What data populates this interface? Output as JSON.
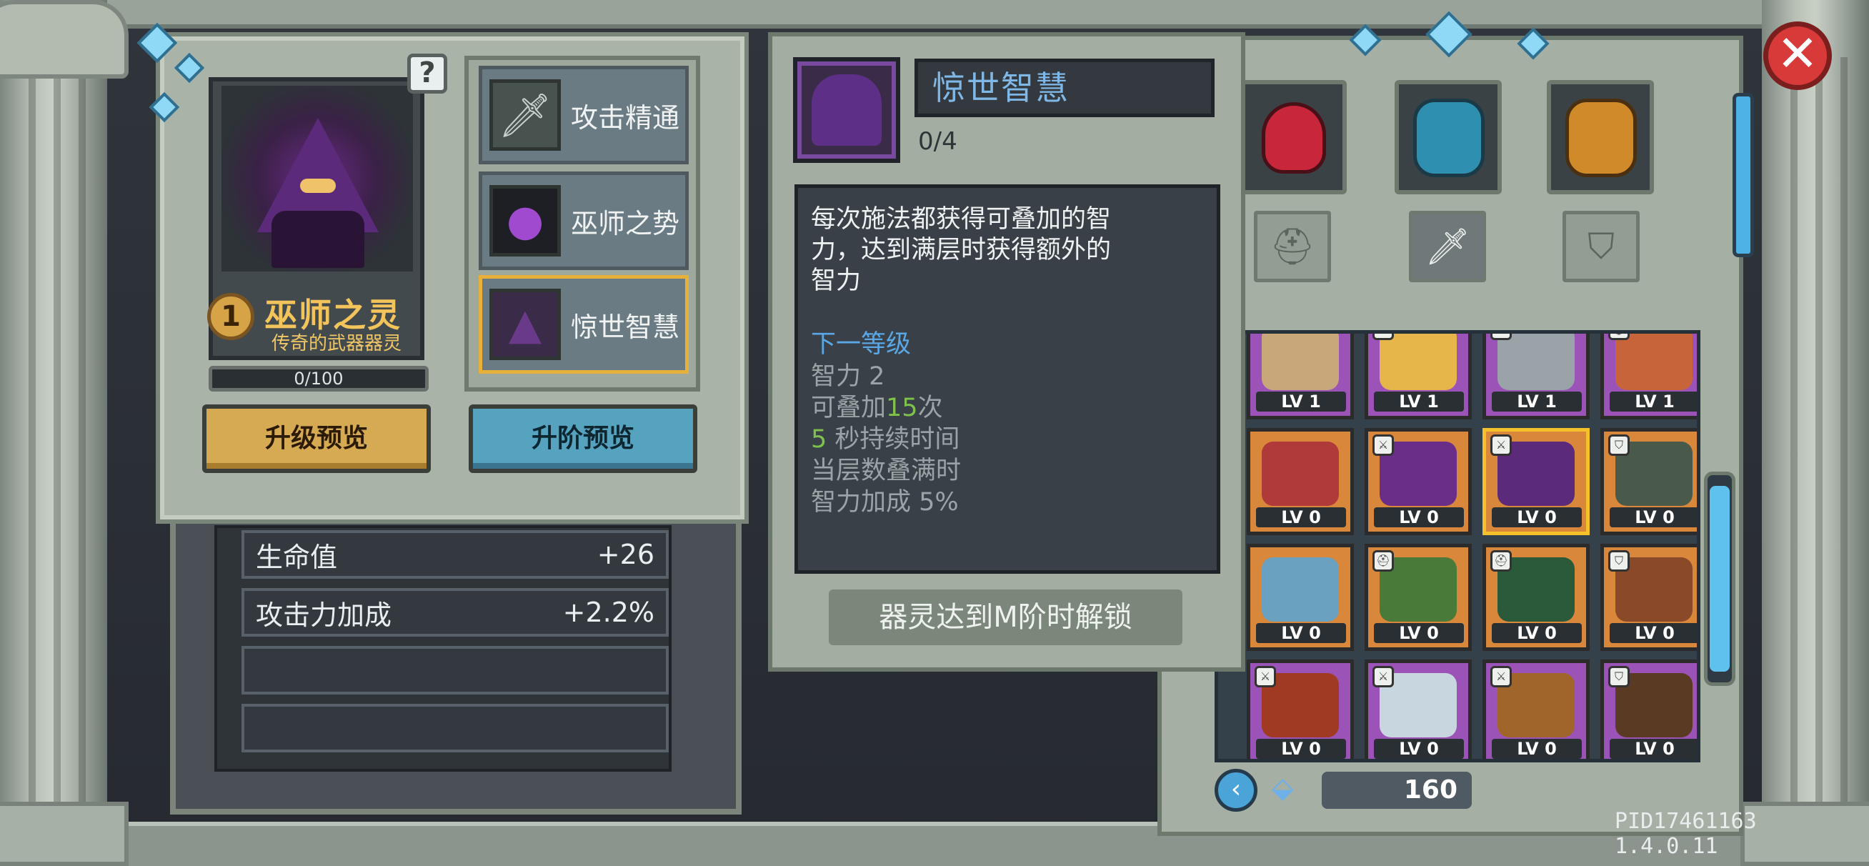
{
  "hero": {
    "rank": "1",
    "name": "巫师之灵",
    "subtitle": "传奇的武器器灵",
    "xp": "0/100",
    "help": "?"
  },
  "skills": [
    {
      "label": "攻击精通",
      "icon": "sword-icon"
    },
    {
      "label": "巫师之势",
      "icon": "purple-flame-icon"
    },
    {
      "label": "惊世智慧",
      "icon": "hood-icon"
    }
  ],
  "buttons": {
    "upgrade_preview": "升级预览",
    "ascend_preview": "升阶预览"
  },
  "stats": [
    {
      "label": "生命值",
      "value": "+26"
    },
    {
      "label": "攻击力加成",
      "value": "+2.2%"
    },
    {
      "label": "",
      "value": ""
    },
    {
      "label": "",
      "value": ""
    }
  ],
  "tooltip": {
    "title": "惊世智慧",
    "level": "0/4",
    "desc_lines": [
      "每次施法都获得可叠加的智",
      "力，达到满层时获得额外的",
      "智力"
    ],
    "next_level": "下一等级",
    "detail_1": "智力 2",
    "detail_2_a": "可叠加",
    "detail_2_b": "15",
    "detail_2_c": "次",
    "detail_3_a": "5",
    "detail_3_b": " 秒持续时间",
    "detail_4": "当层数叠满时",
    "detail_5": "智力加成 5%",
    "unlock": "器灵达到M阶时解锁"
  },
  "inventory": {
    "categories": [
      "red-potion-icon",
      "blue-crystal-monster-icon",
      "orange-crystal-monster-icon"
    ],
    "filters": [
      "helmet-filter-icon",
      "weapon-filter-icon",
      "shield-filter-icon"
    ],
    "cards": [
      {
        "rarity": "purple",
        "level": "LV 1",
        "tag": "",
        "art": "#c8a87a"
      },
      {
        "rarity": "purple",
        "level": "LV 1",
        "tag": "⚔",
        "art": "#e6b64a"
      },
      {
        "rarity": "purple",
        "level": "LV 1",
        "tag": "⚔",
        "art": "#9aa3a8"
      },
      {
        "rarity": "purple",
        "level": "LV 1",
        "tag": "⛑",
        "art": "#c8643a"
      },
      {
        "rarity": "orange",
        "level": "LV 0",
        "tag": "",
        "art": "#b03a3a"
      },
      {
        "rarity": "orange",
        "level": "LV 0",
        "tag": "⚔",
        "art": "#6a2e88"
      },
      {
        "rarity": "orange",
        "level": "LV 0",
        "tag": "⚔",
        "art": "#5b2a7a"
      },
      {
        "rarity": "orange",
        "level": "LV 0",
        "tag": "⛉",
        "art": "#4a5a4a"
      },
      {
        "rarity": "orange",
        "level": "LV 0",
        "tag": "",
        "art": "#6aa0c0"
      },
      {
        "rarity": "orange",
        "level": "LV 0",
        "tag": "⛑",
        "art": "#4a7a3a"
      },
      {
        "rarity": "orange",
        "level": "LV 0",
        "tag": "⛑",
        "art": "#2a5a3a"
      },
      {
        "rarity": "orange",
        "level": "LV 0",
        "tag": "⛉",
        "art": "#8a4a2a"
      },
      {
        "rarity": "purple",
        "level": "LV 0",
        "tag": "⚔",
        "art": "#a03a22"
      },
      {
        "rarity": "purple",
        "level": "LV 0",
        "tag": "⚔",
        "art": "#c8d6e0"
      },
      {
        "rarity": "purple",
        "level": "LV 0",
        "tag": "⚔",
        "art": "#a0652a"
      },
      {
        "rarity": "purple",
        "level": "LV 0",
        "tag": "⛉",
        "art": "#5a3a22"
      }
    ],
    "coins": "160"
  },
  "version": "PID17461163 1.4.0.11",
  "colors": {
    "accent_gold": "#d6aa52",
    "accent_blue": "#56a3c0",
    "rarity_purple": "#9c53b8",
    "rarity_orange": "#d9873a",
    "close_red": "#d83a3a"
  }
}
